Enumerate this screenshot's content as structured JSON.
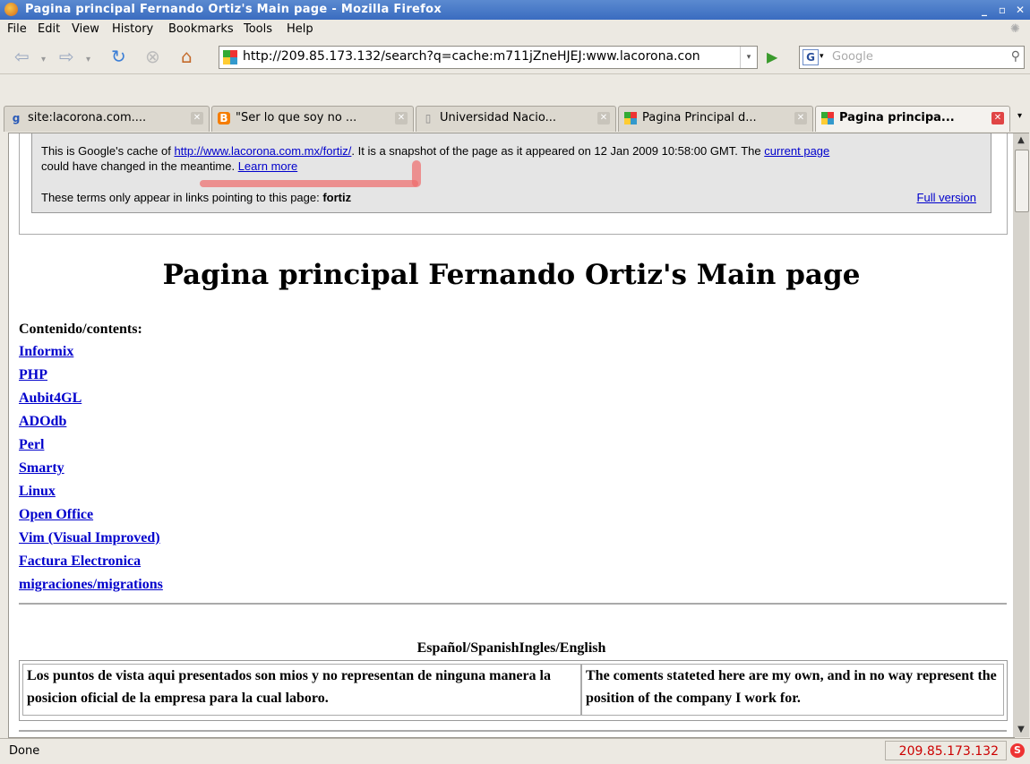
{
  "window": {
    "title": "Pagina principal Fernando Ortiz's Main page - Mozilla Firefox"
  },
  "menu": [
    "File",
    "Edit",
    "View",
    "History",
    "Bookmarks",
    "Tools",
    "Help"
  ],
  "nav": {
    "url": "http://209.85.173.132/search?q=cache:m711jZneHJEJ:www.lacorona.con",
    "search_placeholder": "Google"
  },
  "tabs": [
    {
      "label": "site:lacorona.com....",
      "icon": "google-g-icon"
    },
    {
      "label": "\"Ser lo que soy no ...",
      "icon": "blogger-icon"
    },
    {
      "label": "Universidad Nacio...",
      "icon": "page-icon"
    },
    {
      "label": "Pagina Principal d...",
      "icon": "google-favicon"
    },
    {
      "label": "Pagina principa...",
      "icon": "google-favicon",
      "active": true
    }
  ],
  "cache": {
    "line1_pre": "This is Google's cache of ",
    "line1_link": "http://www.lacorona.com.mx/fortiz/",
    "line1_post": ". It is a snapshot of the page as it appeared on 12 Jan 2009 10:58:00 GMT. The ",
    "current_page": "current page",
    "line2_pre": "could have changed in the meantime. ",
    "learn_more": "Learn more",
    "terms_pre": "These terms only appear in links pointing to this page: ",
    "terms_bold": "fortiz",
    "full_version": "Full version"
  },
  "page": {
    "title": "Pagina principal Fernando Ortiz's Main page",
    "contents_heading": "Contenido/contents:",
    "links": [
      "Informix",
      "PHP",
      "Aubit4GL",
      "ADOdb",
      "Perl",
      "Smarty",
      "Linux",
      "Open Office",
      "Vim (Visual Improved)",
      "Factura Electronica",
      "migraciones/migrations"
    ],
    "lang_heading": "Español/SpanishIngles/English",
    "disclaimer_es": "Los puntos de vista aqui presentados son mios y no representan de ninguna manera la posicion oficial de la empresa para la cual laboro.",
    "disclaimer_en": "The coments stateted here are my own, and in no way represent the position of the company I work for."
  },
  "status": {
    "text": "Done",
    "ip": "209.85.173.132"
  }
}
